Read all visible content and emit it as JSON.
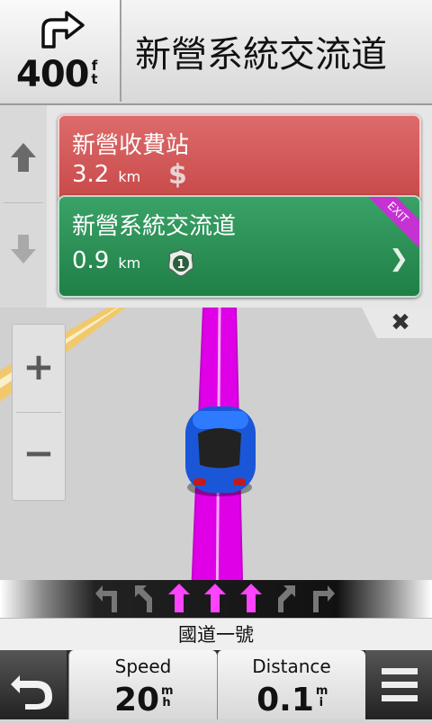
{
  "next_turn": {
    "distance": "400",
    "unit_top": "f",
    "unit_bottom": "t",
    "icon": "turn-right-arrow-icon",
    "street": "新營系統交流道"
  },
  "rail": {
    "up_icon": "arrow-up-icon",
    "down_icon": "arrow-down-icon"
  },
  "upcoming": [
    {
      "name": "新營收費站",
      "distance": "3.2",
      "unit": "km",
      "icon": "toll-dollar-icon",
      "icon_text": "$",
      "color": "#c84848"
    },
    {
      "name": "新營系統交流道",
      "distance": "0.9",
      "unit": "km",
      "icon": "freeway-shield-icon",
      "shield_text": "1",
      "exit_label": "EXIT",
      "chevron": "❯",
      "color": "#1f7f47"
    }
  ],
  "map": {
    "zoom_in": "+",
    "zoom_out": "−",
    "close": "✖",
    "route_color": "#e000e8",
    "vehicle_color": "#1a57d8"
  },
  "lanes": [
    {
      "dir": "left",
      "active": false
    },
    {
      "dir": "left-bend",
      "active": false
    },
    {
      "dir": "straight",
      "active": true
    },
    {
      "dir": "straight",
      "active": true
    },
    {
      "dir": "straight",
      "active": true
    },
    {
      "dir": "right-bend",
      "active": false
    },
    {
      "dir": "right",
      "active": false
    }
  ],
  "current_road": "國道一號",
  "bottom": {
    "back_icon": "back-arrow-icon",
    "menu_icon": "menu-icon",
    "speed": {
      "label": "Speed",
      "value": "20",
      "unit_top": "m",
      "unit_bottom": "h"
    },
    "distance": {
      "label": "Distance",
      "value": "0.1",
      "unit_top": "m",
      "unit_bottom": "i"
    }
  }
}
